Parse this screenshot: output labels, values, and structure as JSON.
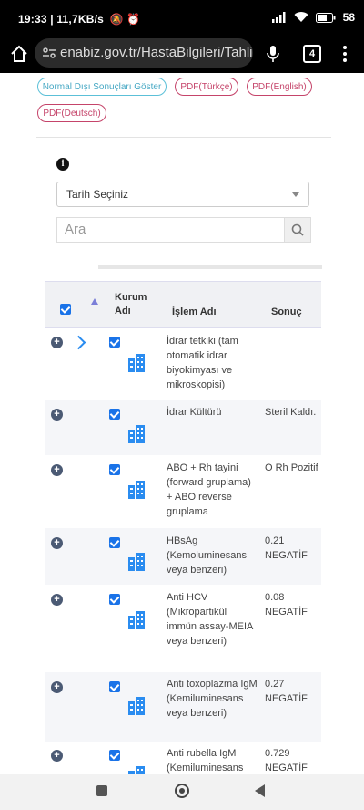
{
  "status_bar": {
    "time": "19:33",
    "speed": "11,7KB/s",
    "battery": "58"
  },
  "browser": {
    "url": "enabiz.gov.tr/HastaBilgileri/Tahliller",
    "tab_count": "4"
  },
  "buttons": {
    "normal_disi": "Normal Dışı Sonuçları Göster",
    "pdf_tr": "PDF(Türkçe)",
    "pdf_en": "PDF(English)",
    "pdf_de": "PDF(Deutsch)"
  },
  "filters": {
    "date_select": "Tarih Seçiniz",
    "search_placeholder": "Ara"
  },
  "table": {
    "headers": {
      "kurum": "Kurum Adı",
      "islem": "İşlem Adı",
      "sonuc": "Sonuç"
    },
    "rows": [
      {
        "islem": "İdrar tetkiki (tam otomatik idrar biyokimyası ve mikroskopisi)",
        "sonuc": ""
      },
      {
        "islem": "İdrar Kültürü",
        "sonuc": "Steril Kaldı."
      },
      {
        "islem": "ABO + Rh tayini (forward gruplama) + ABO reverse gruplama",
        "sonuc": "O Rh Pozitif"
      },
      {
        "islem": "HBsAg (Kemoluminesans veya benzeri)",
        "sonuc": "0.21 NEGATİF"
      },
      {
        "islem": "Anti HCV (Mikropartikül immün assay-MEIA veya benzeri)",
        "sonuc": "0.08 NEGATİF"
      },
      {
        "islem": "Anti toxoplazma IgM (Kemiluminesans veya benzeri)",
        "sonuc": "0.27 NEGATİF"
      },
      {
        "islem": "Anti rubella IgM (Kemiluminesans veya benzeri)",
        "sonuc": "0.729 NEGATİF"
      }
    ]
  },
  "colors": {
    "accent_blue": "#1a73e8",
    "pdf_red": "#c5446a",
    "normal_blue": "#5cc0d8"
  },
  "icons": [
    "home-icon",
    "site-settings-icon",
    "mic-icon",
    "tabs-icon",
    "menu-icon",
    "info-icon",
    "search-icon",
    "expand-icon",
    "chevron-right-icon",
    "building-icon",
    "sort-icon"
  ]
}
